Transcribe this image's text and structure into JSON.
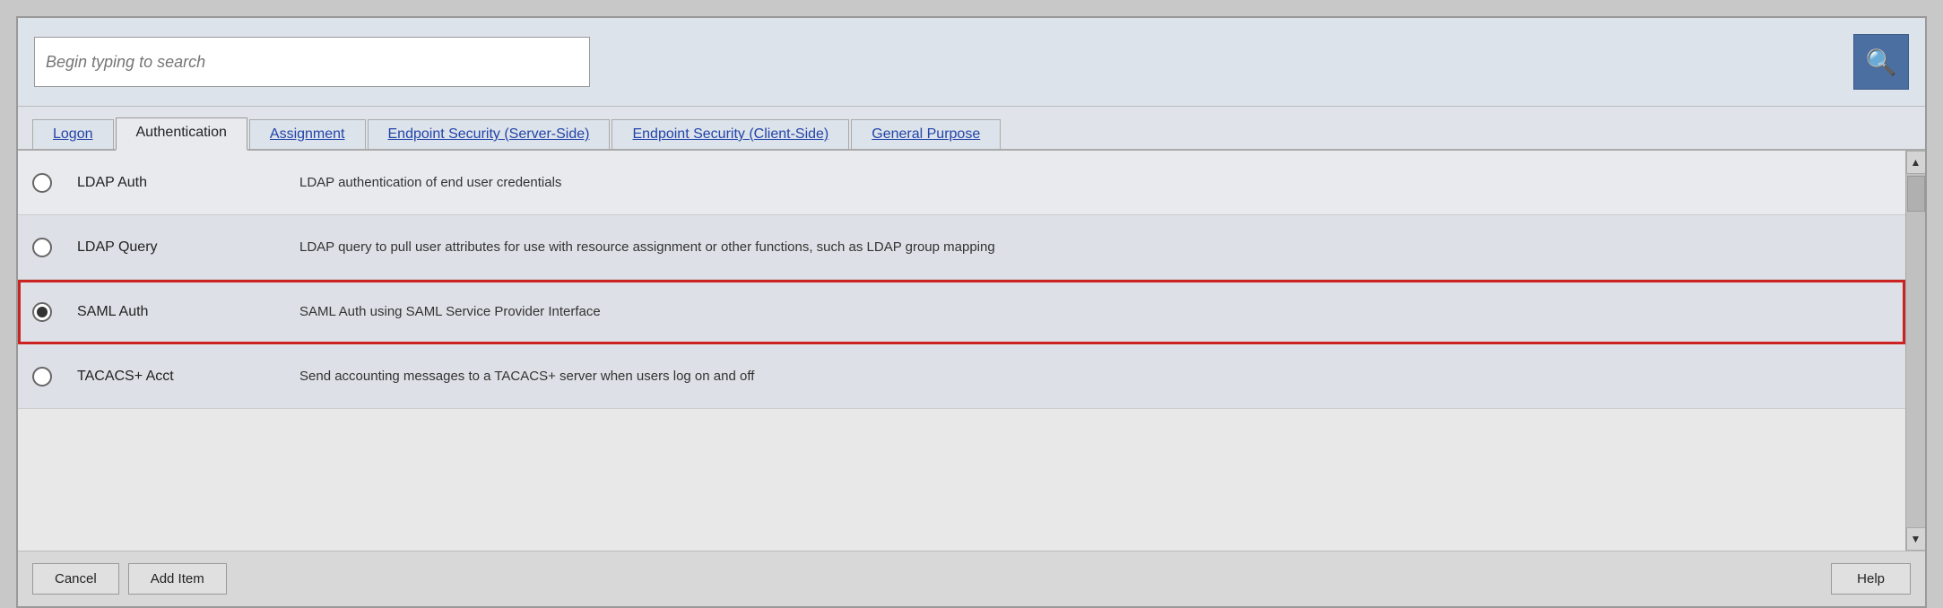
{
  "search": {
    "placeholder": "Begin typing to search",
    "value": ""
  },
  "search_icon": "🔍",
  "tabs": [
    {
      "id": "logon",
      "label": "Logon",
      "active": false,
      "link": true
    },
    {
      "id": "authentication",
      "label": "Authentication",
      "active": true,
      "link": false
    },
    {
      "id": "assignment",
      "label": "Assignment",
      "active": false,
      "link": true
    },
    {
      "id": "endpoint-server",
      "label": "Endpoint Security (Server-Side)",
      "active": false,
      "link": true
    },
    {
      "id": "endpoint-client",
      "label": "Endpoint Security (Client-Side)",
      "active": false,
      "link": true
    },
    {
      "id": "general",
      "label": "General Purpose",
      "active": false,
      "link": true
    }
  ],
  "rows": [
    {
      "id": "ldap-auth",
      "name": "LDAP Auth",
      "description": "LDAP authentication of end user credentials",
      "selected": false
    },
    {
      "id": "ldap-query",
      "name": "LDAP Query",
      "description": "LDAP query to pull user attributes for use with resource assignment or other functions, such as LDAP group mapping",
      "selected": false
    },
    {
      "id": "saml-auth",
      "name": "SAML Auth",
      "description": "SAML Auth using SAML Service Provider Interface",
      "selected": true
    },
    {
      "id": "tacacs-acct",
      "name": "TACACS+ Acct",
      "description": "Send accounting messages to a TACACS+ server when users log on and off",
      "selected": false
    }
  ],
  "footer": {
    "cancel_label": "Cancel",
    "add_item_label": "Add Item",
    "help_label": "Help"
  },
  "scrollbar": {
    "up_arrow": "▲",
    "down_arrow": "▼"
  }
}
